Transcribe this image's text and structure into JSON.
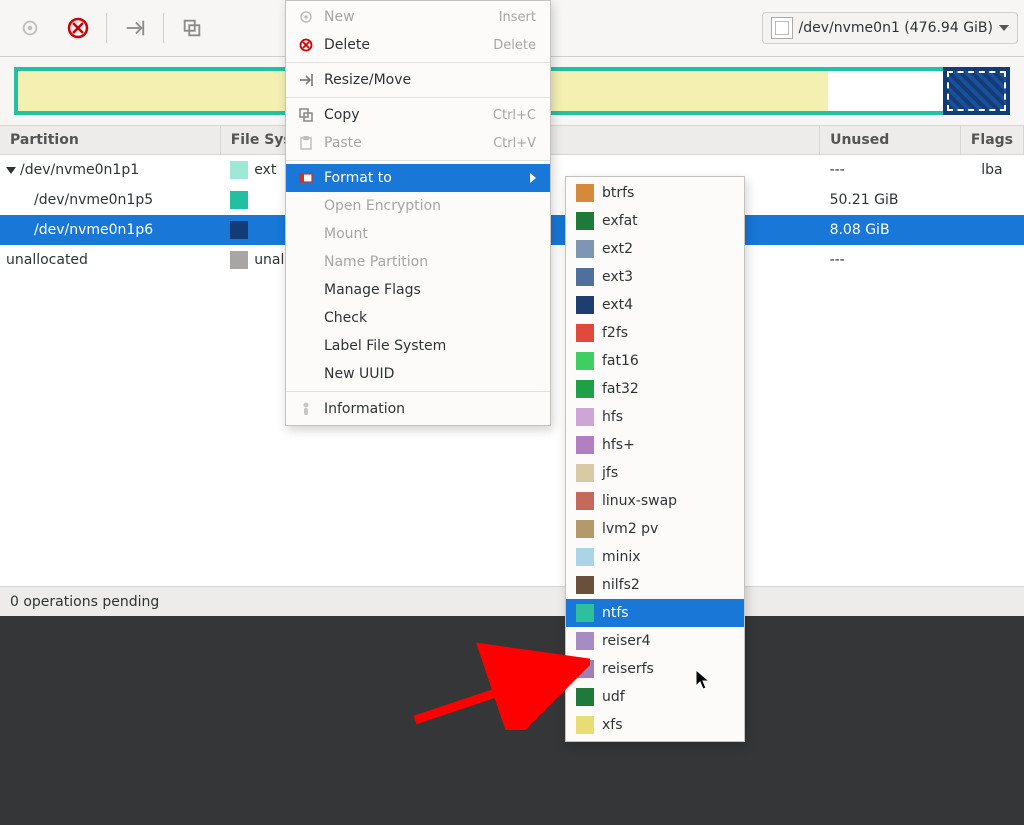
{
  "device_picker": {
    "label": "/dev/nvme0n1 (476.94 GiB)"
  },
  "columns": {
    "partition": "Partition",
    "filesystem": "File System",
    "unused": "Unused",
    "flags": "Flags"
  },
  "rows": [
    {
      "name": "/dev/nvme0n1p1",
      "indent": 0,
      "tri": true,
      "sw": "#9fe8d8",
      "fs": "ext",
      "unused": "---",
      "flags": "lba"
    },
    {
      "name": "/dev/nvme0n1p5",
      "indent": 1,
      "tri": false,
      "sw": "#22bfa3",
      "fs": "",
      "unused": "50.21 GiB",
      "flags": ""
    },
    {
      "name": "/dev/nvme0n1p6",
      "indent": 1,
      "tri": false,
      "sw": "#133b76",
      "fs": "",
      "unused": "8.08 GiB",
      "flags": "",
      "sel": true
    },
    {
      "name": "unallocated",
      "indent": 0,
      "tri": false,
      "sw": "#a7a6a5",
      "fs": "unallo",
      "unused": "---",
      "flags": ""
    }
  ],
  "status": "0 operations pending",
  "ctx_menu": [
    {
      "icon": "new",
      "label": "New",
      "accel": "Insert",
      "disabled": true
    },
    {
      "icon": "delete",
      "label": "Delete",
      "accel": "Delete"
    },
    {
      "sep": true
    },
    {
      "icon": "resize",
      "label": "Resize/Move"
    },
    {
      "sep": true
    },
    {
      "icon": "copy",
      "label": "Copy",
      "accel": "Ctrl+C"
    },
    {
      "icon": "paste",
      "label": "Paste",
      "accel": "Ctrl+V",
      "disabled": true
    },
    {
      "sep": true
    },
    {
      "icon": "format",
      "label": "Format to",
      "sub": true,
      "hl": true
    },
    {
      "label": "Open Encryption",
      "disabled": true
    },
    {
      "label": "Mount",
      "disabled": true
    },
    {
      "label": "Name Partition",
      "disabled": true
    },
    {
      "label": "Manage Flags"
    },
    {
      "label": "Check"
    },
    {
      "label": "Label File System"
    },
    {
      "label": "New UUID"
    },
    {
      "sep": true
    },
    {
      "icon": "info",
      "label": "Information"
    }
  ],
  "fs_menu": [
    {
      "c": "#d5893b",
      "n": "btrfs"
    },
    {
      "c": "#1e7a3a",
      "n": "exfat"
    },
    {
      "c": "#7e95b4",
      "n": "ext2"
    },
    {
      "c": "#4f6f9c",
      "n": "ext3"
    },
    {
      "c": "#1f3e70",
      "n": "ext4"
    },
    {
      "c": "#e04a3c",
      "n": "f2fs"
    },
    {
      "c": "#3ecf60",
      "n": "fat16"
    },
    {
      "c": "#1ea046",
      "n": "fat32"
    },
    {
      "c": "#cda5d6",
      "n": "hfs"
    },
    {
      "c": "#b47fc2",
      "n": "hfs+"
    },
    {
      "c": "#d9caa5",
      "n": "jfs"
    },
    {
      "c": "#c36a5c",
      "n": "linux-swap"
    },
    {
      "c": "#b49a6a",
      "n": "lvm2 pv"
    },
    {
      "c": "#a9d5e5",
      "n": "minix"
    },
    {
      "c": "#6a4f3b",
      "n": "nilfs2"
    },
    {
      "c": "#2fbf9f",
      "n": "ntfs",
      "hl": true
    },
    {
      "c": "#a58cc2",
      "n": "reiser4"
    },
    {
      "c": "#9a82b5",
      "n": "reiserfs"
    },
    {
      "c": "#1e7a3a",
      "n": "udf"
    },
    {
      "c": "#e7dd74",
      "n": "xfs"
    }
  ]
}
